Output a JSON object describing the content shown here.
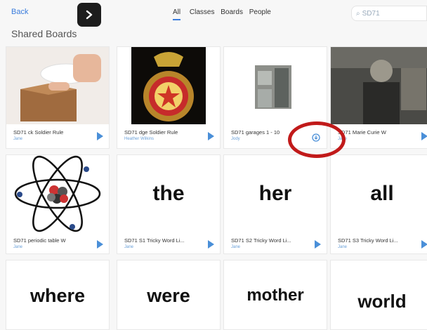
{
  "header": {
    "back_label": "Back",
    "filters": [
      "All",
      "Classes",
      "Boards",
      "People"
    ],
    "active_filter": "All",
    "search_value": "SD71"
  },
  "page_title": "Shared Boards",
  "colors": {
    "accent": "#3b7ddd",
    "highlight_circle": "#c11a1a"
  },
  "cards": [
    {
      "caption": "SD71 ck Soldier Rule",
      "owner": "Jane"
    },
    {
      "caption": "SD71 dge Soldier Rule",
      "owner": "Heather Wilkins"
    },
    {
      "caption": "SD71 garages 1 - 10",
      "owner": "Jody"
    },
    {
      "caption": "SD71 Marie Curie W",
      "owner": "Jane"
    },
    {
      "caption": "SD71 periodic table W",
      "owner": "Jane"
    },
    {
      "caption": "SD71 S1 Tricky Word Li...",
      "owner": "Jane",
      "word": "the"
    },
    {
      "caption": "SD71 S2 Tricky Word Li...",
      "owner": "Jane",
      "word": "her"
    },
    {
      "caption": "SD71 S3 Tricky Word Li...",
      "owner": "Jane",
      "word": "all"
    },
    {
      "word": "where"
    },
    {
      "word": "were"
    },
    {
      "word": "mother"
    },
    {
      "word": "world"
    }
  ]
}
